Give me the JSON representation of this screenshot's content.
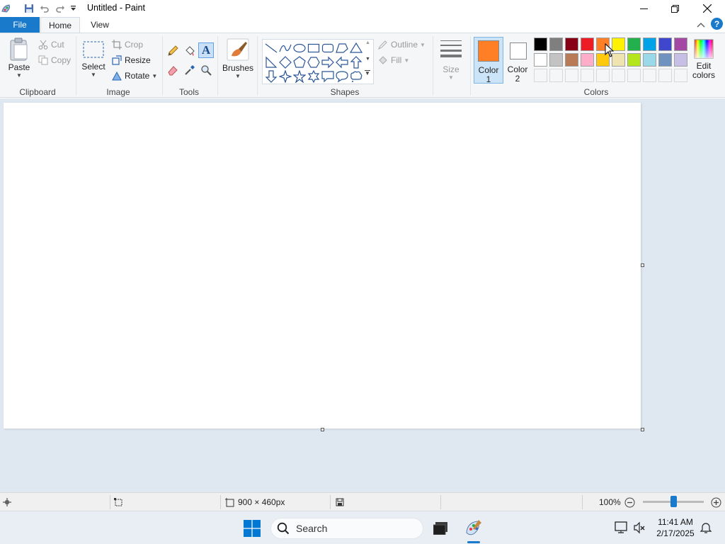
{
  "window": {
    "title": "Untitled - Paint",
    "minimize_icon": "minimize-icon",
    "maximize_icon": "maximize-icon",
    "close_icon": "close-icon"
  },
  "tabs": {
    "file": "File",
    "home": "Home",
    "view": "View"
  },
  "ribbon": {
    "clipboard": {
      "label": "Clipboard",
      "paste": "Paste",
      "cut": "Cut",
      "copy": "Copy"
    },
    "image": {
      "label": "Image",
      "select": "Select",
      "crop": "Crop",
      "resize": "Resize",
      "rotate": "Rotate"
    },
    "tools": {
      "label": "Tools"
    },
    "brushes": {
      "label": "Brushes"
    },
    "shapes": {
      "label": "Shapes",
      "outline": "Outline",
      "fill": "Fill"
    },
    "size": {
      "label": "Size"
    },
    "colors": {
      "label": "Colors",
      "color1_line1": "Color",
      "color1_line2": "1",
      "color2_line1": "Color",
      "color2_line2": "2",
      "edit_line1": "Edit",
      "edit_line2": "colors",
      "color1_value": "#ff7f27",
      "color2_value": "#ffffff",
      "palette_row1": [
        "#000000",
        "#7f7f7f",
        "#880015",
        "#ed1c24",
        "#ff7f27",
        "#fff200",
        "#22b14c",
        "#00a2e8",
        "#3f48cc",
        "#a349a4"
      ],
      "palette_row2": [
        "#ffffff",
        "#c3c3c3",
        "#b97a57",
        "#ffaec9",
        "#ffc90e",
        "#efe4b0",
        "#b5e61d",
        "#99d9ea",
        "#7092be",
        "#c8bfe7"
      ]
    }
  },
  "status": {
    "canvas_size": "900 × 460px",
    "zoom": "100%",
    "zoom_level": 0.5
  },
  "taskbar": {
    "search_placeholder": "Search",
    "time": "11:41 AM",
    "date": "2/17/2025"
  }
}
